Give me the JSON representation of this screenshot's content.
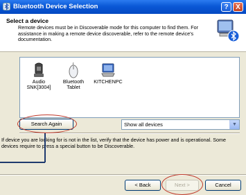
{
  "window": {
    "title": "Bluetooth Device Selection",
    "help_label": "?",
    "close_label": "X"
  },
  "header": {
    "title": "Select a device",
    "description": "Remote devices must be in Discoverable mode for this computer to find them. For assistance in making a remote device discoverable, refer to the remote device's documentation."
  },
  "devices": [
    {
      "label": "Audio SNK[3004]",
      "icon": "audio-device-icon"
    },
    {
      "label": "Bluetooth Tablet",
      "icon": "mouse-device-icon"
    },
    {
      "label": "KITCHENPC",
      "icon": "computer-device-icon"
    }
  ],
  "controls": {
    "search_again_label": "Search Again",
    "filter_selected": "Show all devices"
  },
  "info_text": "If device you are looking for is not in the list, verify that the device has power and is operational. Some devices require to press a special button to be Discoverable.",
  "footer": {
    "back_label": "< Back",
    "next_label": "Next >",
    "cancel_label": "Cancel"
  },
  "colors": {
    "titlebar": "#0a58d6",
    "annotation": "#c0392b"
  }
}
